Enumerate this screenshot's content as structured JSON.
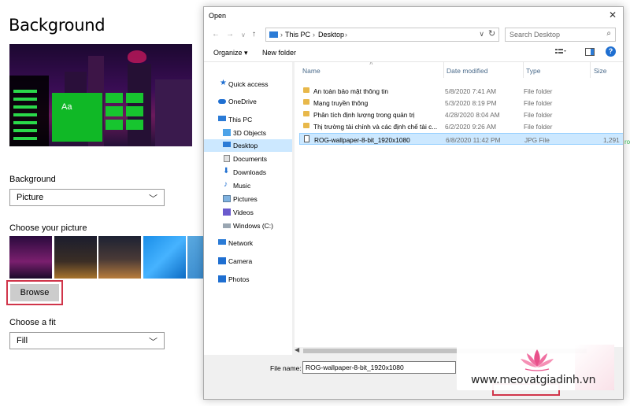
{
  "settings": {
    "page_title": "Background",
    "preview_tile_text": "Aa",
    "background_label": "Background",
    "background_value": "Picture",
    "choose_picture_label": "Choose your picture",
    "browse_label": "Browse",
    "fit_label": "Choose a fit",
    "fit_value": "Fill"
  },
  "dialog": {
    "title": "Open",
    "close_glyph": "✕",
    "breadcrumb": [
      "This PC",
      "Desktop"
    ],
    "search_placeholder": "Search Desktop",
    "organize_label": "Organize",
    "new_folder_label": "New folder",
    "help_glyph": "?",
    "nav_items": [
      {
        "label": "Quick access",
        "icon": "star-icon"
      },
      {
        "label": "OneDrive",
        "icon": "cloud-icon"
      },
      {
        "label": "This PC",
        "icon": "computer-icon"
      },
      {
        "label": "3D Objects",
        "icon": "cube-icon"
      },
      {
        "label": "Desktop",
        "icon": "desktop-icon"
      },
      {
        "label": "Documents",
        "icon": "document-icon"
      },
      {
        "label": "Downloads",
        "icon": "download-icon"
      },
      {
        "label": "Music",
        "icon": "music-icon"
      },
      {
        "label": "Pictures",
        "icon": "pictures-icon"
      },
      {
        "label": "Videos",
        "icon": "video-icon"
      },
      {
        "label": "Windows (C:)",
        "icon": "drive-icon"
      },
      {
        "label": "Network",
        "icon": "network-icon"
      },
      {
        "label": "Camera",
        "icon": "camera-icon"
      },
      {
        "label": "Photos",
        "icon": "photos-icon"
      }
    ],
    "columns": [
      "Name",
      "Date modified",
      "Type",
      "Size"
    ],
    "files": [
      {
        "name": "An toàn bảo mật thông tin",
        "date": "5/8/2020 7:41 AM",
        "type": "File folder",
        "size": ""
      },
      {
        "name": "Mạng truyền thông",
        "date": "5/3/2020 8:19 PM",
        "type": "File folder",
        "size": ""
      },
      {
        "name": "Phân tích định lượng trong quản trị",
        "date": "4/28/2020 8:04 AM",
        "type": "File folder",
        "size": ""
      },
      {
        "name": "Thị trường tài chính và các định chế tài c...",
        "date": "6/2/2020 9:26 AM",
        "type": "File folder",
        "size": ""
      },
      {
        "name": "ROG-wallpaper-8-bit_1920x1080",
        "date": "6/8/2020 11:42 PM",
        "type": "JPG File",
        "size": "1,291"
      }
    ],
    "file_name_label": "File name:",
    "file_name_value": "ROG-wallpaper-8-bit_1920x1080"
  },
  "watermark": {
    "site": "www.meovatgiadinh.vn"
  },
  "edge_text": "ro",
  "colors": {
    "accent": "#1f6fd1",
    "selection": "#cce8ff",
    "highlight_border": "#d0354a",
    "tile_green": "#10b826"
  }
}
